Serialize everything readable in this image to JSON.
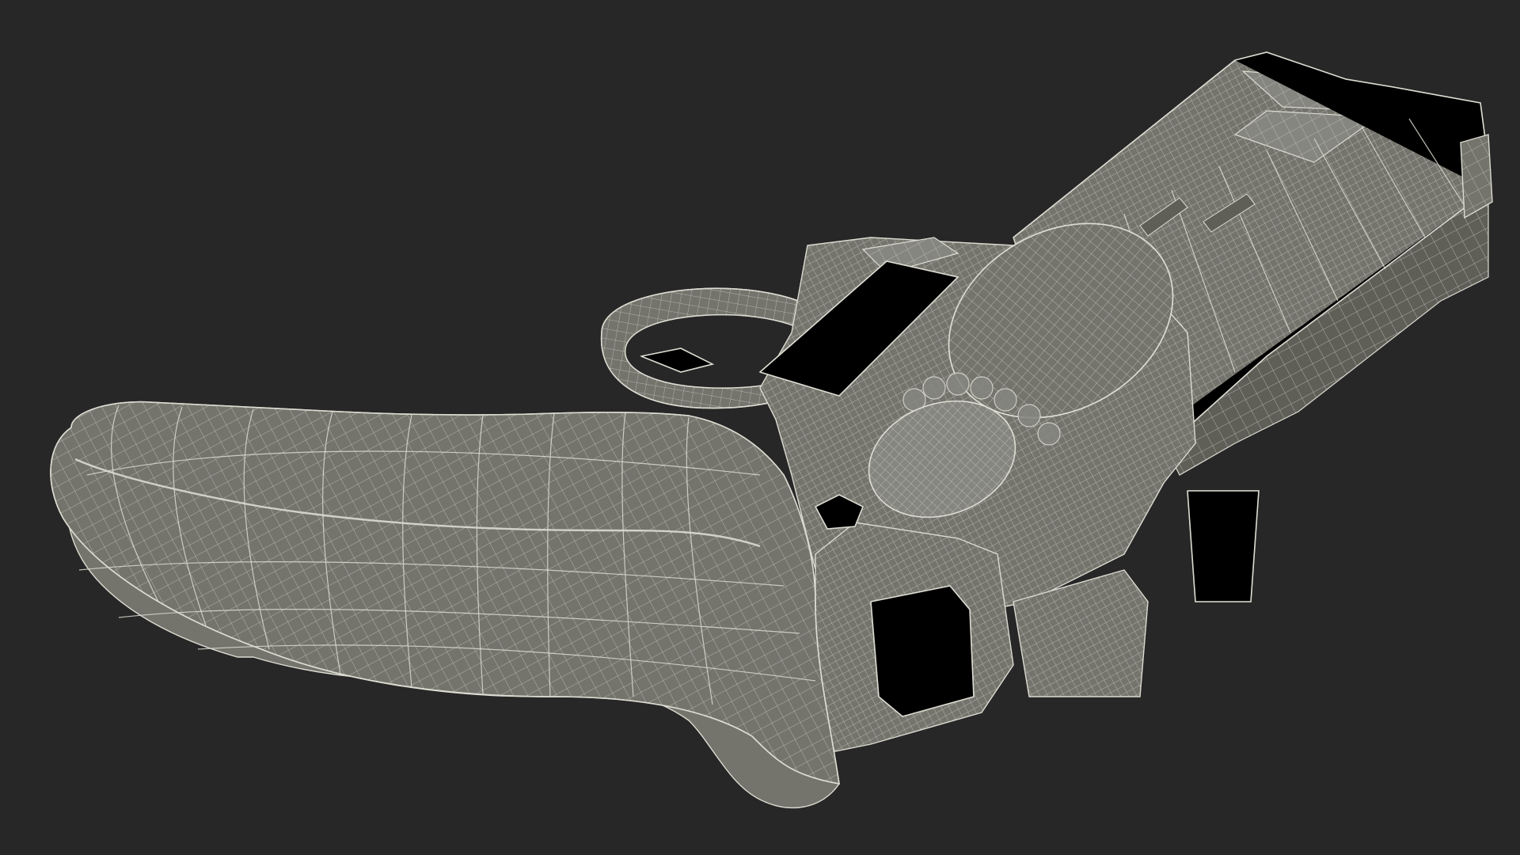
{
  "scene": {
    "subject": "revolver-wireframe-render",
    "background_color": "#272727",
    "surface_color": "#74746d",
    "surface_dark_color": "#5f5f58",
    "surface_light_color": "#868680",
    "wire_color": "#dcdcd2",
    "wire_dense_color": "#c8c8be"
  }
}
